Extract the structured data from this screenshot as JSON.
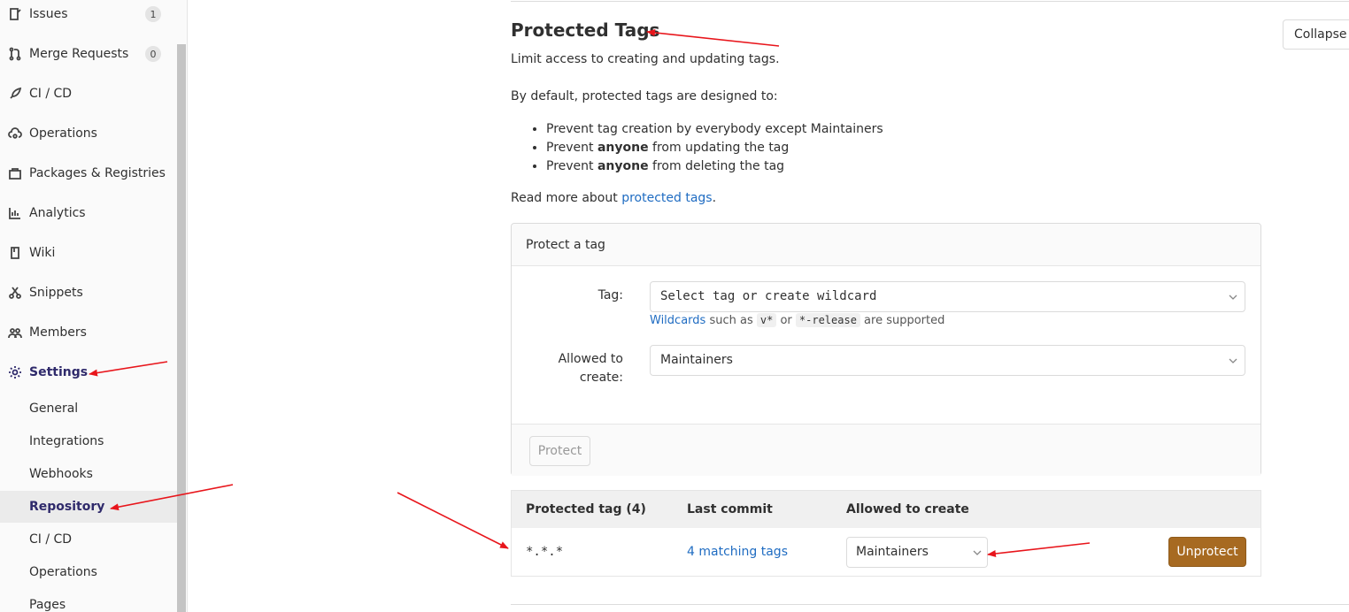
{
  "sidebar": {
    "items": [
      {
        "label": "Issues",
        "icon": "issues-icon",
        "badge": "1"
      },
      {
        "label": "Merge Requests",
        "icon": "merge-request-icon",
        "badge": "0"
      },
      {
        "label": "CI / CD",
        "icon": "rocket-icon"
      },
      {
        "label": "Operations",
        "icon": "cloud-gear-icon"
      },
      {
        "label": "Packages & Registries",
        "icon": "package-icon"
      },
      {
        "label": "Analytics",
        "icon": "chart-icon"
      },
      {
        "label": "Wiki",
        "icon": "book-icon"
      },
      {
        "label": "Snippets",
        "icon": "scissors-icon"
      },
      {
        "label": "Members",
        "icon": "users-icon"
      },
      {
        "label": "Settings",
        "icon": "gear-icon"
      }
    ],
    "settings_sub": [
      "General",
      "Integrations",
      "Webhooks",
      "Repository",
      "CI / CD",
      "Operations",
      "Pages"
    ]
  },
  "section": {
    "title": "Protected Tags",
    "collapse_label": "Collapse",
    "subtitle": "Limit access to creating and updating tags.",
    "intro": "By default, protected tags are designed to:",
    "bullets": [
      {
        "pre": "Prevent tag creation by everybody except Maintainers",
        "bold": "",
        "post": ""
      },
      {
        "pre": "Prevent ",
        "bold": "anyone",
        "post": " from updating the tag"
      },
      {
        "pre": "Prevent ",
        "bold": "anyone",
        "post": " from deleting the tag"
      }
    ],
    "readmore_pre": "Read more about ",
    "readmore_link": "protected tags",
    "readmore_post": "."
  },
  "protect_form": {
    "header": "Protect a tag",
    "tag_label": "Tag:",
    "tag_placeholder": "Select tag or create wildcard",
    "helper_link": "Wildcards",
    "helper_text1": " such as ",
    "helper_code1": "v*",
    "helper_text2": " or ",
    "helper_code2": "*-release",
    "helper_text3": " are supported",
    "allowed_label_line1": "Allowed to",
    "allowed_label_line2": "create:",
    "allowed_value": "Maintainers",
    "protect_button": "Protect"
  },
  "table": {
    "headers": [
      "Protected tag (4)",
      "Last commit",
      "Allowed to create"
    ],
    "rows": [
      {
        "tag": "*.*.*",
        "last_commit": "4 matching tags",
        "allowed": "Maintainers",
        "action": "Unprotect"
      }
    ]
  },
  "colors": {
    "accent": "#2f2a6b",
    "link": "#1f6cc2",
    "unprotect": "#a76a21",
    "annotation_arrow": "#e8151b"
  }
}
